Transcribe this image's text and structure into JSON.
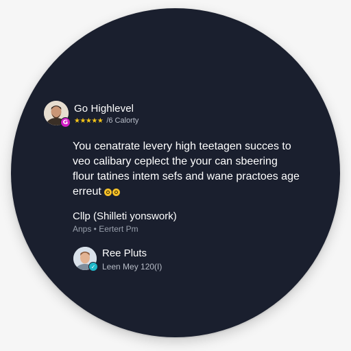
{
  "header": {
    "name": "Go Highlevel",
    "stars": "★★★★★",
    "meta": "/6 Calorty",
    "badge": "G"
  },
  "review": {
    "lines": [
      "You cenatrate levery high teetagen succes to",
      "veo calibary ceplect the your can sbeering",
      "flour tatines intem sefs and wane practoes age",
      "erreut"
    ]
  },
  "section": {
    "title": "Cllp (Shilleti yonswork)",
    "subtitle": "Anps • Eertert Pm"
  },
  "user": {
    "name": "Ree Pluts",
    "subtitle": "Leen Mey 120(I)",
    "badge": "✓"
  },
  "colors": {
    "panel": "#1a1f2e",
    "star": "#f5c518",
    "header_badge": "#d21dc6",
    "user_badge": "#20b8c9"
  },
  "icons": {
    "header_avatar": "person-photo",
    "user_avatar": "person-photo",
    "emojis": [
      "smile-emoji",
      "smile-emoji"
    ]
  }
}
